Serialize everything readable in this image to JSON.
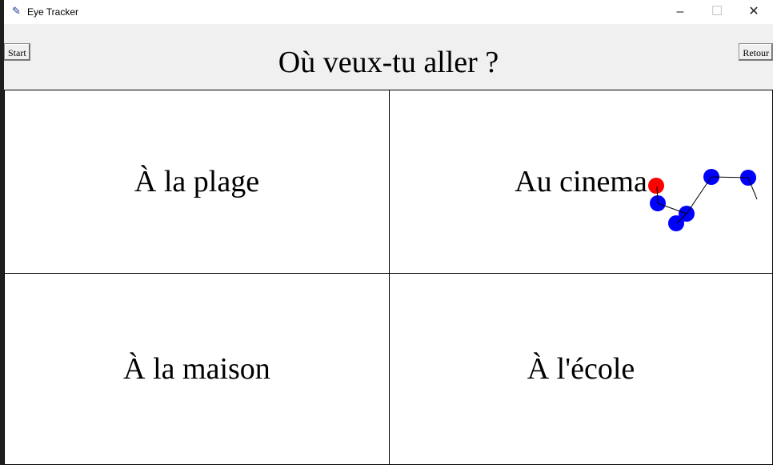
{
  "window": {
    "title": "Eye Tracker",
    "icon": "feather-icon"
  },
  "header": {
    "start_label": "Start",
    "back_label": "Retour",
    "question": "Où veux-tu aller ?"
  },
  "cells": [
    {
      "label": "À la plage"
    },
    {
      "label": "Au cinema"
    },
    {
      "label": "À la maison"
    },
    {
      "label": "À l'école"
    }
  ],
  "gaze": {
    "current_color": "#ff0000",
    "history_color": "#0000ff"
  }
}
